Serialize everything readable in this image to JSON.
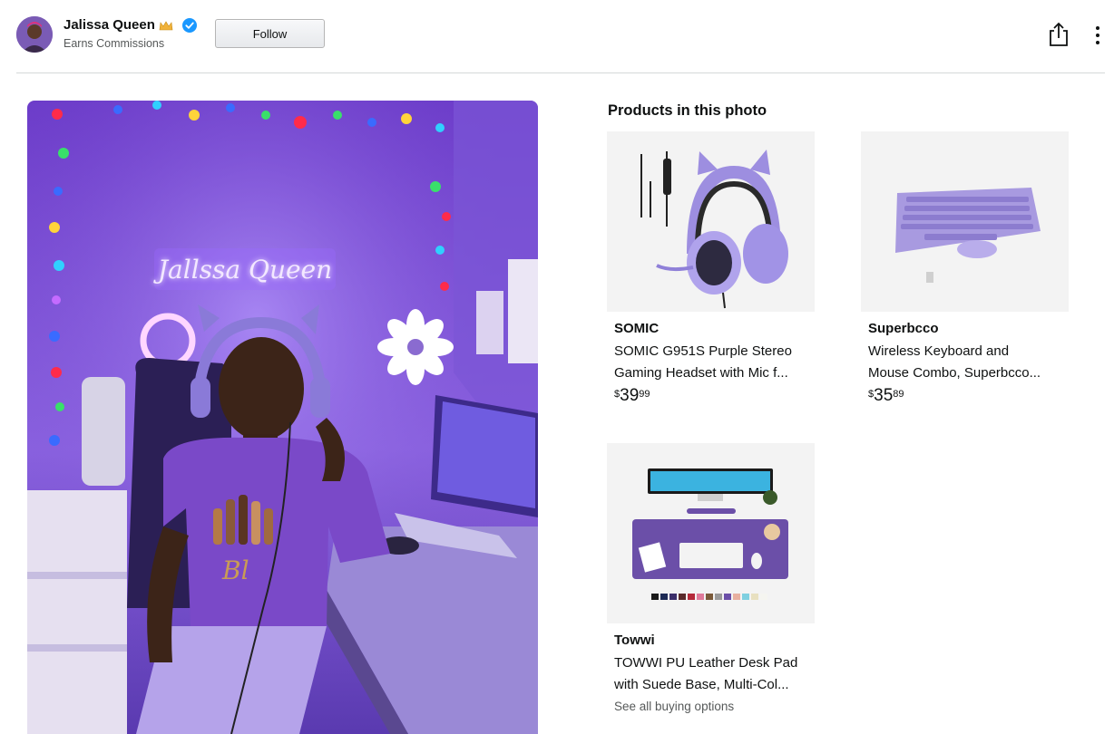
{
  "creator": {
    "name": "Jalissa Queen",
    "subtitle": "Earns Commissions",
    "follow_label": "Follow"
  },
  "icons": {
    "crown": "crown-icon",
    "verified": "verified-badge-icon",
    "share": "share-icon",
    "more": "more-vertical-icon"
  },
  "photo": {
    "neon_sign_text": "Jallssa Queen"
  },
  "products": {
    "heading": "Products in this photo",
    "items": [
      {
        "brand": "SOMIC",
        "title_line1": "SOMIC G951S Purple Stereo",
        "title_line2": "Gaming Headset with Mic f...",
        "price_symbol": "$",
        "price_whole": "39",
        "price_fraction": "99"
      },
      {
        "brand": "Superbcco",
        "title_line1": "Wireless Keyboard and",
        "title_line2": "Mouse Combo, Superbcco...",
        "price_symbol": "$",
        "price_whole": "35",
        "price_fraction": "89"
      },
      {
        "brand": "Towwi",
        "title_line1": "TOWWI PU Leather Desk Pad",
        "title_line2": "with Suede Base, Multi-Col...",
        "buying_options": "See all buying options"
      }
    ]
  },
  "colors": {
    "accent_verified": "#1a98ff",
    "text_primary": "#0f1111",
    "text_secondary": "#565959",
    "divider": "#d5d9d9",
    "card_bg": "#f3f3f3",
    "neon_purple": "#8a5cf6"
  }
}
